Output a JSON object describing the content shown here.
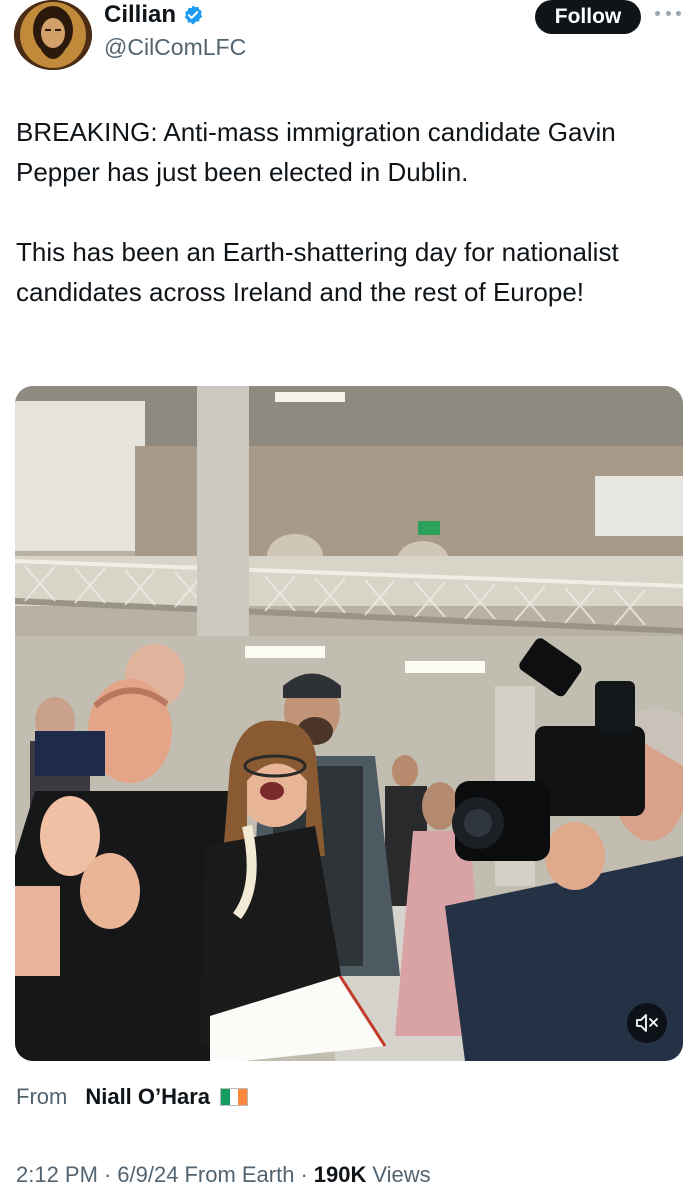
{
  "author": {
    "display_name": "Cillian",
    "handle": "@CilComLFC",
    "verified_icon": "verified-badge-icon",
    "avatar_icon": "avatar-portrait-icon"
  },
  "follow_label": "Follow",
  "more_icon": "more-options-icon",
  "tweet": {
    "paragraph_1": "BREAKING: Anti-mass immigration candidate Gavin Pepper has just been elected in Dublin.",
    "paragraph_2": "This has been an Earth-shattering day for nationalist candidates across Ireland and the rest of Europe!"
  },
  "media": {
    "type": "video",
    "mute_icon": "muted-speaker-icon"
  },
  "source": {
    "from_label": "From",
    "name": "Niall O’Hara",
    "flag_icon": "ireland-flag-icon"
  },
  "meta": {
    "time": "2:12 PM",
    "date": "6/9/24",
    "via": "From Earth",
    "views_count": "190K",
    "views_label": "Views"
  },
  "colors": {
    "text": "#0f1419",
    "secondary": "#536471",
    "verified": "#1d9bf0",
    "follow_bg": "#0f1419"
  }
}
